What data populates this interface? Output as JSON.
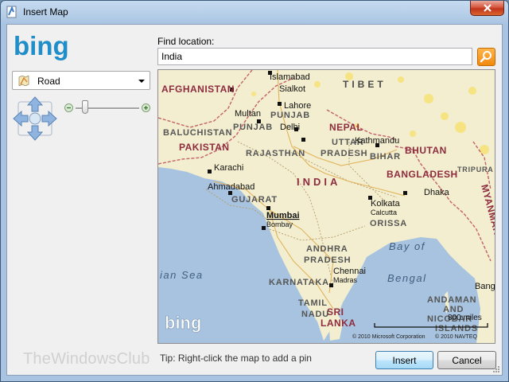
{
  "window": {
    "title": "Insert Map"
  },
  "left": {
    "logo": "bing",
    "map_style": {
      "selected": "Road",
      "icon": "road-map-icon"
    },
    "zoom": {
      "out_icon": "minus-icon",
      "in_icon": "plus-icon",
      "level": 0.15
    }
  },
  "search": {
    "label": "Find location:",
    "value": "India",
    "button_icon": "search-icon"
  },
  "map": {
    "countries": [
      "AFGHANISTAN",
      "PAKISTAN",
      "INDIA",
      "NEPAL",
      "BHUTAN",
      "BANGLADESH",
      "MYANMAR",
      "TIBET",
      "SRI LANKA"
    ],
    "regions": [
      "BALUCHISTAN",
      "PUNJAB",
      "PUNJAB",
      "RAJASTHAN",
      "GUJARAT",
      "UTTAR",
      "PRADESH",
      "BIHAR",
      "ORISSA",
      "ANDHRA",
      "PRADESH",
      "KARNATAKA",
      "TAMIL",
      "NADU",
      "ANDAMAN",
      "AND",
      "NICOBAR",
      "ISLANDS",
      "TRIPURA"
    ],
    "cities": [
      "Islamabad",
      "Sialkot",
      "Lahore",
      "Multan",
      "Delhi",
      "Karachi",
      "Ahmadabad",
      "Mumbai",
      "Bombay",
      "Kathmandu",
      "Kolkata",
      "Calcutta",
      "Dhaka",
      "Chennai",
      "Madras",
      "Bang"
    ],
    "seas": [
      "Bay of",
      "Bengal",
      "ian Sea"
    ],
    "scale": "800 miles",
    "copyright_left": "© 2010 Microsoft Corporation",
    "copyright_right": "© 2010 NAVTEQ",
    "watermark_logo": "bing"
  },
  "footer": {
    "tip": "Tip: Right-click the map to add a pin",
    "insert_label": "Insert",
    "cancel_label": "Cancel",
    "watermark": "TheWindowsClub"
  },
  "colors": {
    "land": "#f2eecf",
    "water": "#a8c3df",
    "accent": "#f18a0f",
    "bing_blue": "#1f8ec9"
  }
}
